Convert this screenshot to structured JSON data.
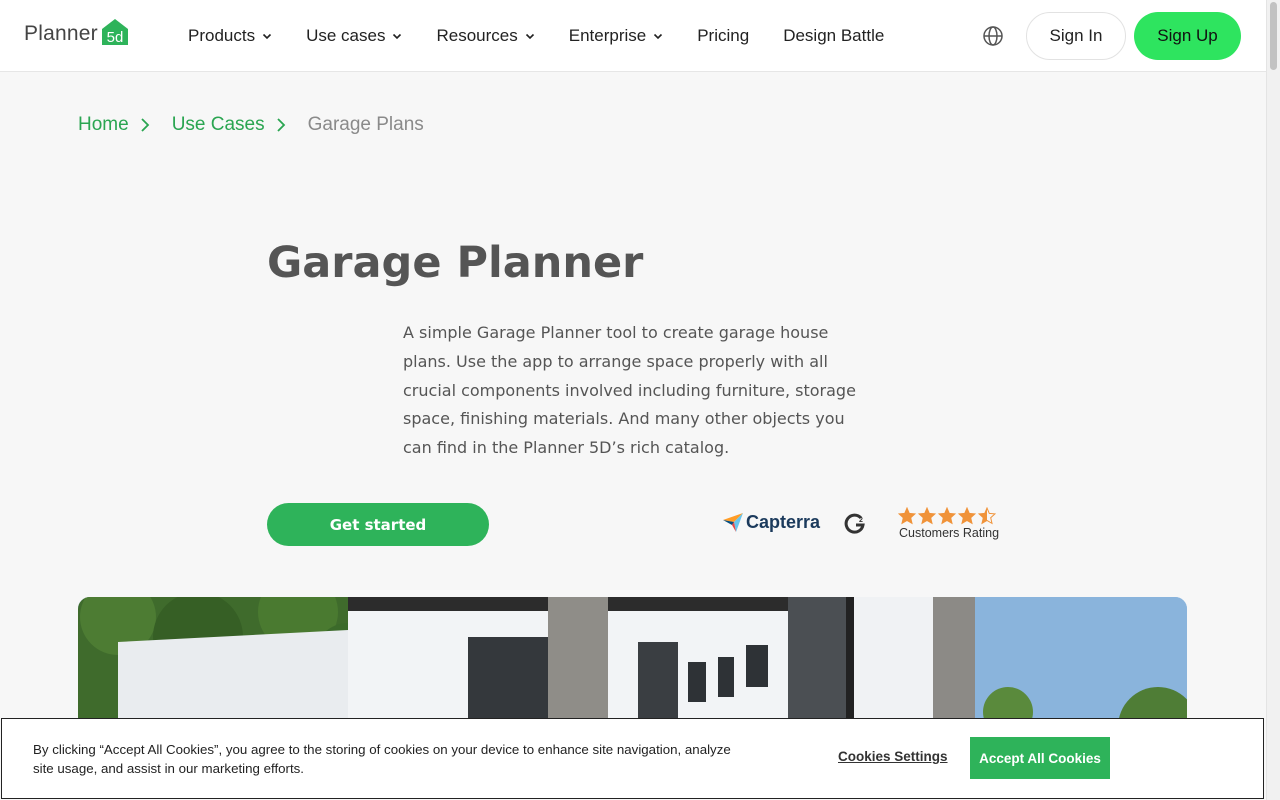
{
  "header": {
    "logo_text": "Planner",
    "logo_badge": "5d",
    "nav": [
      {
        "label": "Products",
        "has_dropdown": true
      },
      {
        "label": "Use cases",
        "has_dropdown": true
      },
      {
        "label": "Resources",
        "has_dropdown": true
      },
      {
        "label": "Enterprise",
        "has_dropdown": true
      },
      {
        "label": "Pricing",
        "has_dropdown": false
      },
      {
        "label": "Design Battle",
        "has_dropdown": false
      }
    ],
    "language_icon": "globe-icon",
    "sign_in_label": "Sign In",
    "sign_up_label": "Sign Up"
  },
  "breadcrumb": {
    "items": [
      {
        "label": "Home"
      },
      {
        "label": "Use Cases"
      }
    ],
    "current": "Garage Plans"
  },
  "hero": {
    "title": "Garage Planner",
    "description": "A simple Garage Planner tool to create garage house plans. Use the app to arrange space properly with all crucial components involved including furniture, storage space, finishing materials. And many other objects you can find in the Planner 5D’s rich catalog.",
    "cta_label": "Get started"
  },
  "ratings": {
    "capterra_label": "Capterra",
    "rating_stars": 4.5,
    "rating_max": 5,
    "rating_label": "Customers Rating"
  },
  "cookie_banner": {
    "text": "By clicking “Accept All Cookies”, you agree to the storing of cookies on your device to enhance site navigation, analyze site usage, and assist in our marketing efforts.",
    "settings_label": "Cookies Settings",
    "accept_label": "Accept All Cookies"
  },
  "colors": {
    "brand_green": "#2eb35a",
    "signup_green": "#2ee45f",
    "link_green": "#2aa551",
    "star_orange": "#f0933a"
  }
}
